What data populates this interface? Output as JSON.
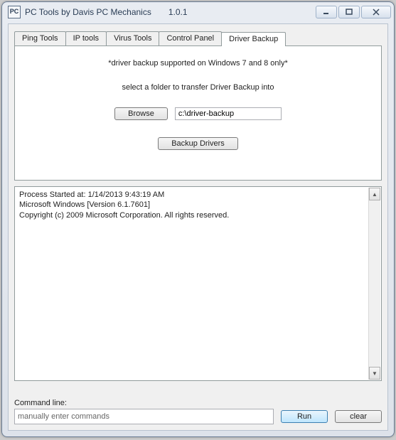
{
  "window": {
    "icon_text": "PC",
    "title": "PC Tools by Davis PC Mechanics",
    "version": "1.0.1"
  },
  "tabs": {
    "ping": "Ping Tools",
    "ip": "IP tools",
    "virus": "Virus Tools",
    "control": "Control Panel",
    "driver": "Driver Backup"
  },
  "panel": {
    "note": "*driver backup supported on Windows 7 and 8 only*",
    "instruction": "select a folder to transfer Driver Backup into",
    "browse_label": "Browse",
    "path_value": "c:\\driver-backup",
    "backup_label": "Backup Drivers"
  },
  "output": {
    "line1": "Process Started at: 1/14/2013 9:43:19 AM",
    "line2": "Microsoft Windows [Version 6.1.7601]",
    "line3": "Copyright (c) 2009 Microsoft Corporation.  All rights reserved."
  },
  "cmd": {
    "label": "Command line:",
    "placeholder": "manually enter commands",
    "run_label": "Run",
    "clear_label": "clear"
  }
}
